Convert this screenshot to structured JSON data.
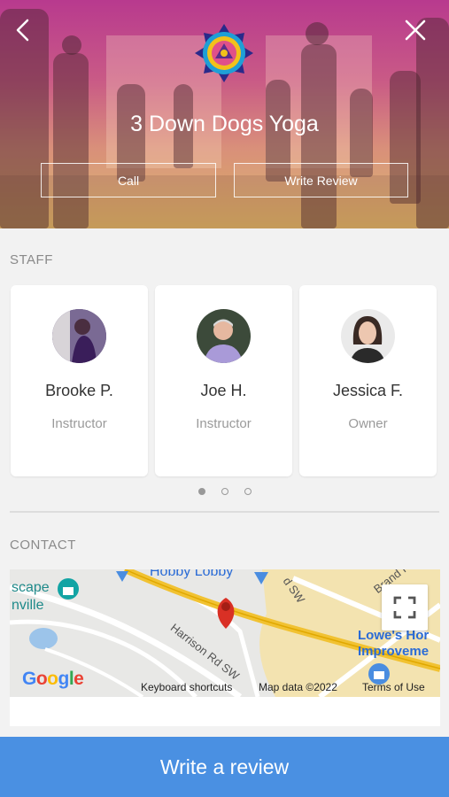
{
  "header": {
    "studio_name": "3 Down Dogs Yoga",
    "call_label": "Call",
    "write_review_label": "Write Review",
    "back_icon": "chevron-left-icon",
    "close_icon": "close-icon"
  },
  "staff": {
    "section_label": "STAFF",
    "members": [
      {
        "name": "Brooke P.",
        "role": "Instructor"
      },
      {
        "name": "Joe H.",
        "role": "Instructor"
      },
      {
        "name": "Jessica F.",
        "role": "Owner"
      }
    ],
    "page_count": 3,
    "active_page": 1
  },
  "contact": {
    "section_label": "CONTACT",
    "map": {
      "places": {
        "hobby_lobby": "Hobby Lobby",
        "escape_partial": "scape",
        "granville_partial": "nville",
        "lowes_line1": "Lowe's Hor",
        "lowes_line2": "Improveme",
        "harrison_road": "Harrison Rd SW",
        "road_sw": "d SW",
        "brand_road": "Brand R"
      },
      "google_label": "Google",
      "keyboard_shortcuts": "Keyboard shortcuts",
      "map_data": "Map data ©2022",
      "terms": "Terms of Use"
    }
  },
  "footer": {
    "write_review_label": "Write a review"
  },
  "colors": {
    "accent": "#4a90e2",
    "marker": "#d93025"
  }
}
